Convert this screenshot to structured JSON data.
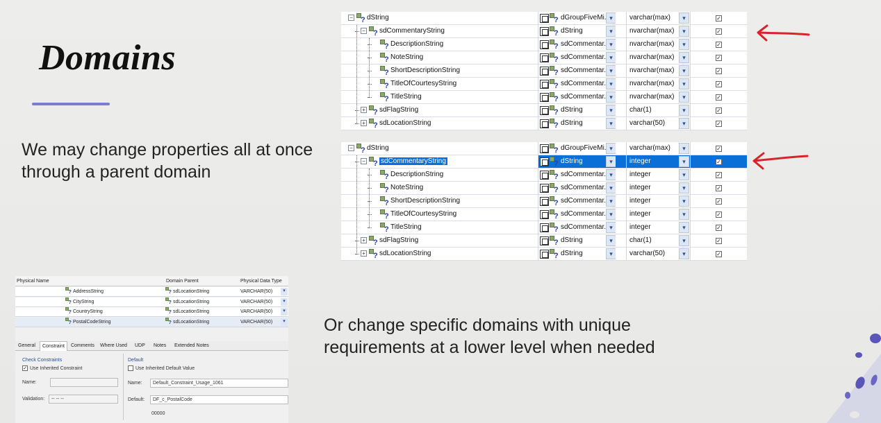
{
  "slide": {
    "title": "Domains",
    "text_parent": "We may change properties all at once through a parent domain",
    "text_specific": "Or change specific domains with unique requirements at a lower level when needed"
  },
  "grid_top": {
    "rows": [
      {
        "name": "dString",
        "parent": "dGroupFiveMi...",
        "type": "varchar(max)",
        "checked": true,
        "level": 0,
        "toggle": "−"
      },
      {
        "name": "sdCommentaryString",
        "parent": "dString",
        "type": "nvarchar(max)",
        "checked": true,
        "level": 1,
        "toggle": "−"
      },
      {
        "name": "DescriptionString",
        "parent": "sdCommentar...",
        "type": "nvarchar(max)",
        "checked": true,
        "level": 2,
        "toggle": ""
      },
      {
        "name": "NoteString",
        "parent": "sdCommentar...",
        "type": "nvarchar(max)",
        "checked": true,
        "level": 2,
        "toggle": ""
      },
      {
        "name": "ShortDescriptionString",
        "parent": "sdCommentar...",
        "type": "nvarchar(max)",
        "checked": true,
        "level": 2,
        "toggle": ""
      },
      {
        "name": "TitleOfCourtesyString",
        "parent": "sdCommentar...",
        "type": "nvarchar(max)",
        "checked": true,
        "level": 2,
        "toggle": ""
      },
      {
        "name": "TitleString",
        "parent": "sdCommentar...",
        "type": "nvarchar(max)",
        "checked": true,
        "level": 2,
        "toggle": ""
      },
      {
        "name": "sdFlagString",
        "parent": "dString",
        "type": "char(1)",
        "checked": true,
        "level": 1,
        "toggle": "+"
      },
      {
        "name": "sdLocationString",
        "parent": "dString",
        "type": "varchar(50)",
        "checked": true,
        "level": 1,
        "toggle": "+"
      }
    ]
  },
  "grid_bottom": {
    "rows": [
      {
        "name": "dString",
        "parent": "dGroupFiveMi...",
        "type": "varchar(max)",
        "checked": true,
        "level": 0,
        "toggle": "−"
      },
      {
        "name": "sdCommentaryString",
        "parent": "dString",
        "type": "integer",
        "checked": true,
        "level": 1,
        "toggle": "−",
        "selected": true
      },
      {
        "name": "DescriptionString",
        "parent": "sdCommentar...",
        "type": "integer",
        "checked": true,
        "level": 2,
        "toggle": ""
      },
      {
        "name": "NoteString",
        "parent": "sdCommentar...",
        "type": "integer",
        "checked": true,
        "level": 2,
        "toggle": ""
      },
      {
        "name": "ShortDescriptionString",
        "parent": "sdCommentar...",
        "type": "integer",
        "checked": true,
        "level": 2,
        "toggle": ""
      },
      {
        "name": "TitleOfCourtesyString",
        "parent": "sdCommentar...",
        "type": "integer",
        "checked": true,
        "level": 2,
        "toggle": ""
      },
      {
        "name": "TitleString",
        "parent": "sdCommentar...",
        "type": "integer",
        "checked": true,
        "level": 2,
        "toggle": ""
      },
      {
        "name": "sdFlagString",
        "parent": "dString",
        "type": "char(1)",
        "checked": true,
        "level": 1,
        "toggle": "+"
      },
      {
        "name": "sdLocationString",
        "parent": "dString",
        "type": "varchar(50)",
        "checked": true,
        "level": 1,
        "toggle": "+"
      }
    ]
  },
  "props": {
    "headers": {
      "physical_name": "Physical Name",
      "domain_parent": "Domain Parent",
      "physical_type": "Physical Data Type"
    },
    "rows": [
      {
        "name": "AddressString",
        "parent": "sdLocationString",
        "type": "VARCHAR(50)"
      },
      {
        "name": "CityString",
        "parent": "sdLocationString",
        "type": "VARCHAR(50)"
      },
      {
        "name": "CountryString",
        "parent": "sdLocationString",
        "type": "VARCHAR(50)"
      },
      {
        "name": "PostalCodeString",
        "parent": "sdLocationString",
        "type": "VARCHAR(50)"
      }
    ],
    "tabs": [
      "General",
      "Constraint",
      "Comments",
      "Where Used",
      "UDP",
      "Notes",
      "Extended Notes"
    ],
    "active_tab": "Constraint",
    "check_constraints": {
      "group": "Check Constraints",
      "use_inherited": "Use Inherited Constraint",
      "name_label": "Name:",
      "validation_label": "Validation:",
      "validation_value": "-- -- --"
    },
    "default": {
      "group": "Default",
      "use_inherited": "Use Inherited Default Value",
      "name_label": "Name:",
      "name_value": "Default_Constraint_Usage_1061",
      "default_label": "Default:",
      "default_value": "DF_c_PostalCode",
      "value": "00000"
    }
  },
  "colors": {
    "accent": "#7b7ed0",
    "arrow": "#d9232b",
    "selection": "#0a6fd6"
  }
}
